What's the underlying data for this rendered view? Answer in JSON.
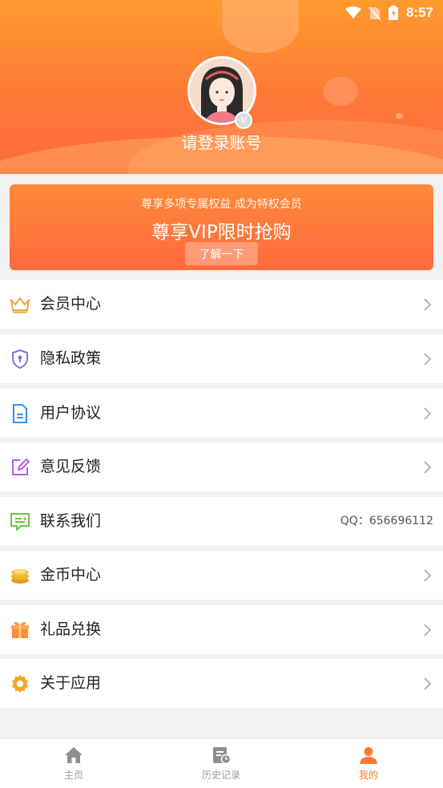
{
  "status_bar": {
    "time": "8:57"
  },
  "profile": {
    "login_text": "请登录账号",
    "vip_mark": "V"
  },
  "vip_banner": {
    "subtitle": "尊享多项专属权益 成为特权会员",
    "title": "尊享VIP限时抢购",
    "button_label": "了解一下"
  },
  "menu": [
    {
      "label": "会员中心",
      "icon": "crown-icon"
    },
    {
      "label": "隐私政策",
      "icon": "shield-icon"
    },
    {
      "label": "用户协议",
      "icon": "document-icon"
    },
    {
      "label": "意见反馈",
      "icon": "edit-icon"
    },
    {
      "label": "联系我们",
      "icon": "message-icon",
      "extra": "QQ：656696112"
    },
    {
      "label": "金币中心",
      "icon": "coins-icon"
    },
    {
      "label": "礼品兑换",
      "icon": "gift-icon"
    },
    {
      "label": "关于应用",
      "icon": "gear-icon"
    }
  ],
  "bottom_nav": [
    {
      "label": "主页",
      "icon": "home-icon"
    },
    {
      "label": "历史记录",
      "icon": "history-icon"
    },
    {
      "label": "我的",
      "icon": "user-icon",
      "active": true
    }
  ],
  "colors": {
    "accent": "#ff7a30",
    "header_top": "#ff9a2e",
    "header_bottom": "#ff6a3d"
  }
}
